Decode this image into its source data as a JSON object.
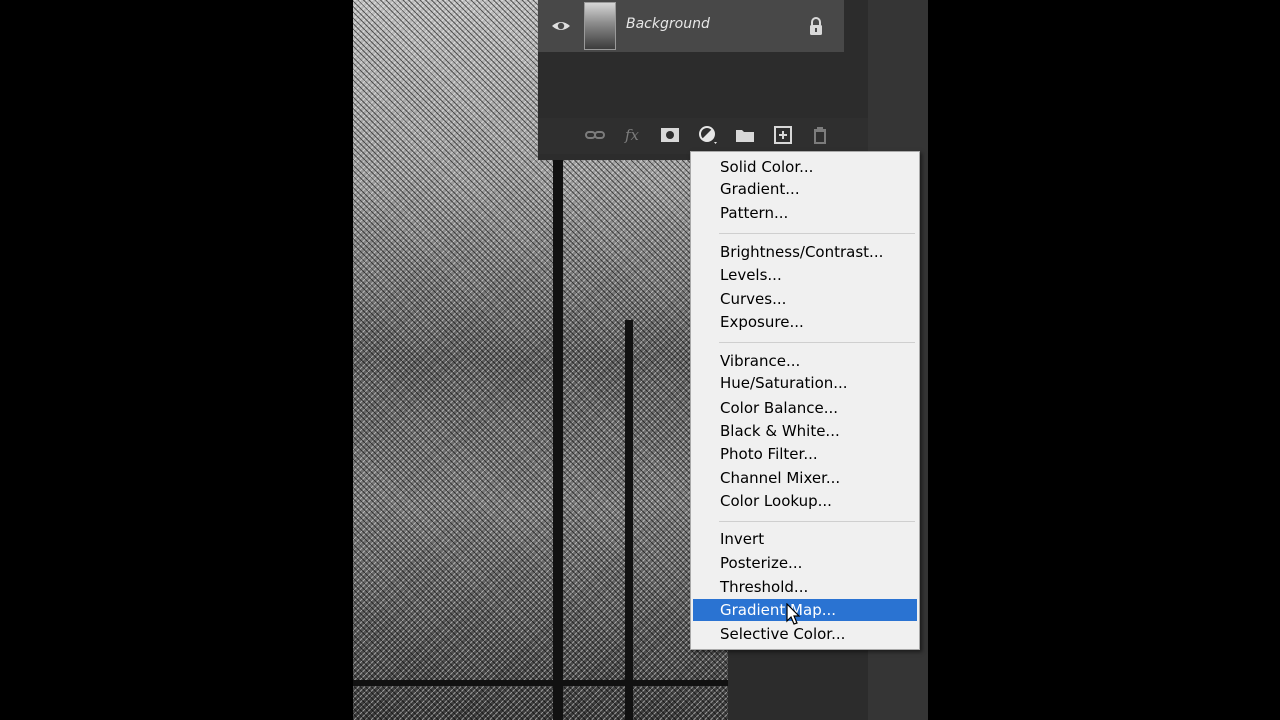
{
  "layers": {
    "name": "Background"
  },
  "toolbar": {
    "icons": [
      "link-icon",
      "fx-icon",
      "mask-icon",
      "adjustment-icon",
      "folder-icon",
      "new-layer-icon",
      "trash-icon"
    ]
  },
  "menu": {
    "groups": [
      [
        "Solid Color...",
        "Gradient...",
        "Pattern..."
      ],
      [
        "Brightness/Contrast...",
        "Levels...",
        "Curves...",
        "Exposure..."
      ],
      [
        "Vibrance...",
        "Hue/Saturation...",
        "Color Balance...",
        "Black & White...",
        "Photo Filter...",
        "Channel Mixer...",
        "Color Lookup..."
      ],
      [
        "Invert",
        "Posterize...",
        "Threshold...",
        "Gradient Map...",
        "Selective Color..."
      ]
    ],
    "selected": "Gradient Map...",
    "highlight_color": "#2a73d2"
  }
}
